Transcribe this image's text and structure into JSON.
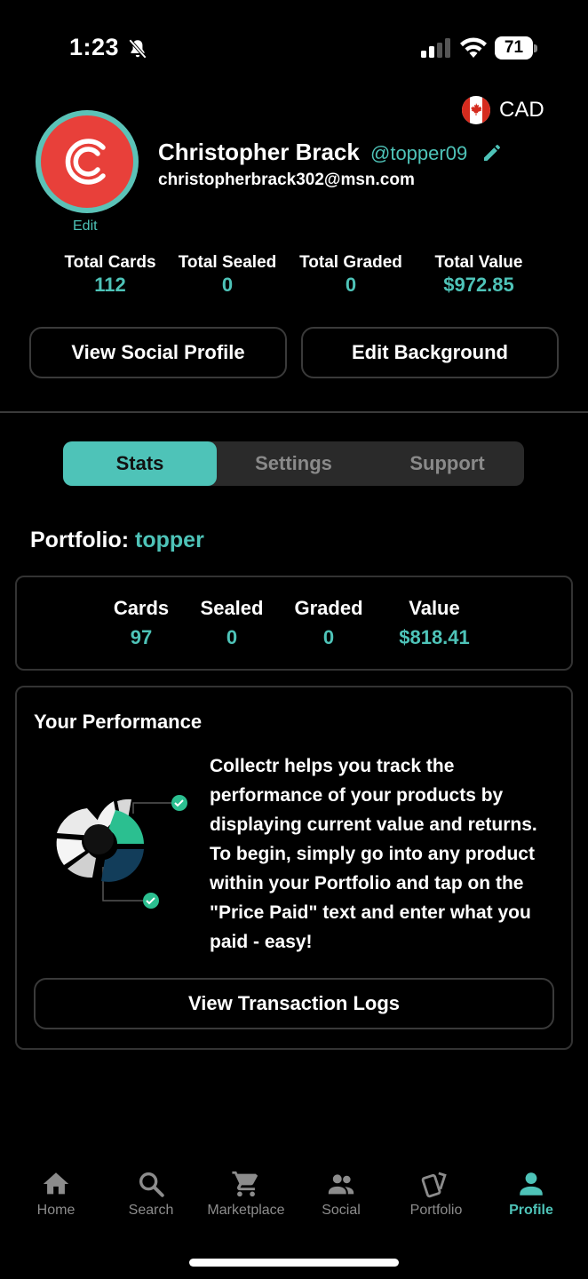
{
  "status_bar": {
    "time": "1:23",
    "battery": "71"
  },
  "currency": {
    "label": "CAD",
    "flag_icon": "canada-flag-icon"
  },
  "profile": {
    "edit_label": "Edit",
    "name": "Christopher Brack",
    "handle": "@topper09",
    "email": "christopherbrack302@msn.com"
  },
  "totals": [
    {
      "label": "Total Cards",
      "value": "112"
    },
    {
      "label": "Total Sealed",
      "value": "0"
    },
    {
      "label": "Total Graded",
      "value": "0"
    },
    {
      "label": "Total Value",
      "value": "$972.85"
    }
  ],
  "buttons": {
    "social": "View Social Profile",
    "background": "Edit Background"
  },
  "tabs": [
    {
      "label": "Stats",
      "active": true
    },
    {
      "label": "Settings",
      "active": false
    },
    {
      "label": "Support",
      "active": false
    }
  ],
  "portfolio": {
    "title_prefix": "Portfolio:",
    "name": "topper",
    "stats": [
      {
        "label": "Cards",
        "value": "97"
      },
      {
        "label": "Sealed",
        "value": "0"
      },
      {
        "label": "Graded",
        "value": "0"
      },
      {
        "label": "Value",
        "value": "$818.41"
      }
    ]
  },
  "performance": {
    "title": "Your Performance",
    "text": "Collectr helps you track the performance of your products by displaying current value and returns. To begin, simply go into any product within your Portfolio and tap on the \"Price Paid\" text and enter what you paid - easy!",
    "button": "View Transaction Logs"
  },
  "nav": [
    {
      "label": "Home",
      "icon": "home-icon",
      "active": false
    },
    {
      "label": "Search",
      "icon": "search-icon",
      "active": false
    },
    {
      "label": "Marketplace",
      "icon": "cart-icon",
      "active": false
    },
    {
      "label": "Social",
      "icon": "people-icon",
      "active": false
    },
    {
      "label": "Portfolio",
      "icon": "cards-icon",
      "active": false
    },
    {
      "label": "Profile",
      "icon": "person-icon",
      "active": true
    }
  ],
  "colors": {
    "accent": "#4ec3b8",
    "background": "#000000",
    "avatar_bg": "#e8403a"
  }
}
